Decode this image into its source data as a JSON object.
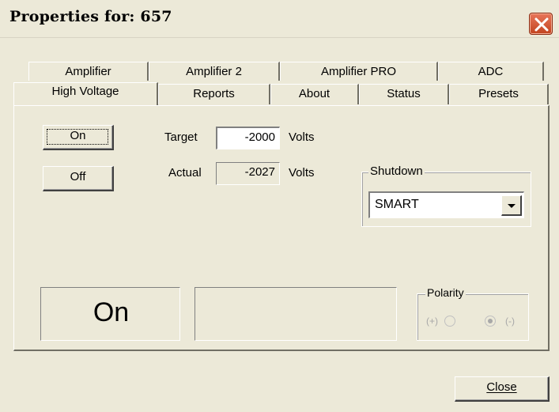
{
  "window": {
    "title": "Properties for:  657",
    "close_icon": "close-icon"
  },
  "tabs": {
    "back": [
      "Amplifier",
      "Amplifier 2",
      "Amplifier PRO",
      "ADC"
    ],
    "front": [
      "High Voltage",
      "Reports",
      "About",
      "Status",
      "Presets"
    ],
    "selected": "High Voltage"
  },
  "hv": {
    "on_button": "On",
    "off_button": "Off",
    "target_label": "Target",
    "target_value": "-2000",
    "target_unit": "Volts",
    "actual_label": "Actual",
    "actual_value": "-2027",
    "actual_unit": "Volts",
    "status_text": "On",
    "message_text": ""
  },
  "shutdown": {
    "title": "Shutdown",
    "value": "SMART"
  },
  "polarity": {
    "title": "Polarity",
    "plus_label": "(+)",
    "minus_label": "(-)",
    "selected": "minus"
  },
  "footer": {
    "close_button": "Close"
  }
}
